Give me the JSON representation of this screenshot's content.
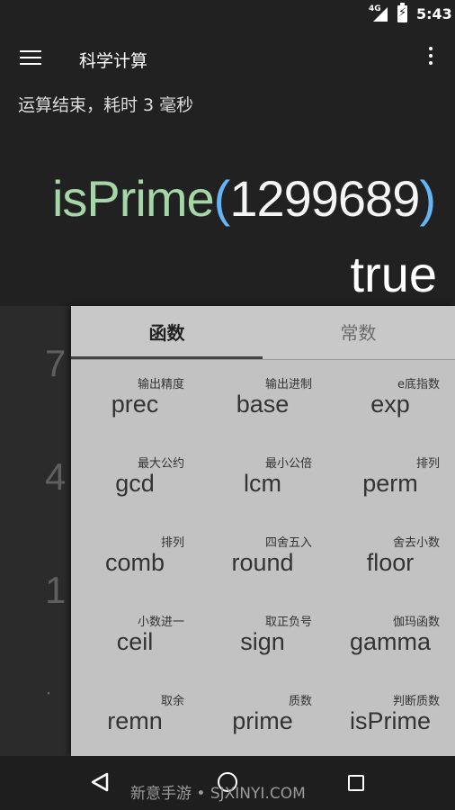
{
  "status_bar": {
    "network": "4G",
    "time": "5:43"
  },
  "toolbar": {
    "title": "科学计算",
    "menu_icon": "hamburger-menu-icon",
    "more_icon": "more-vert-icon"
  },
  "display": {
    "status": "运算结束，耗时 3 毫秒",
    "expression": {
      "function": "isPrime",
      "open_paren": "(",
      "argument": "1299689",
      "close_paren": ")"
    },
    "result": "true",
    "colors": {
      "function": "#a5d6a7",
      "paren": "#64b5f6",
      "text": "#ffffff"
    }
  },
  "keypad": {
    "digits": [
      "7",
      "4",
      "1",
      "·"
    ]
  },
  "panel": {
    "tabs": [
      {
        "label": "函数",
        "selected": true
      },
      {
        "label": "常数",
        "selected": false
      }
    ],
    "functions": [
      {
        "label": "输出精度",
        "name": "prec"
      },
      {
        "label": "输出进制",
        "name": "base"
      },
      {
        "label": "e底指数",
        "name": "exp"
      },
      {
        "label": "最大公约",
        "name": "gcd"
      },
      {
        "label": "最小公倍",
        "name": "lcm"
      },
      {
        "label": "排列",
        "name": "perm"
      },
      {
        "label": "排列",
        "name": "comb"
      },
      {
        "label": "四舍五入",
        "name": "round"
      },
      {
        "label": "舍去小数",
        "name": "floor"
      },
      {
        "label": "小数进一",
        "name": "ceil"
      },
      {
        "label": "取正负号",
        "name": "sign"
      },
      {
        "label": "伽玛函数",
        "name": "gamma"
      },
      {
        "label": "取余",
        "name": "remn"
      },
      {
        "label": "质数",
        "name": "prime"
      },
      {
        "label": "判断质数",
        "name": "isPrime"
      }
    ]
  },
  "nav_bar": {
    "back_icon": "back-triangle-icon",
    "home_icon": "home-circle-icon",
    "recents_icon": "recents-square-icon"
  },
  "watermark": "新意手游 • SJXINYI.COM"
}
